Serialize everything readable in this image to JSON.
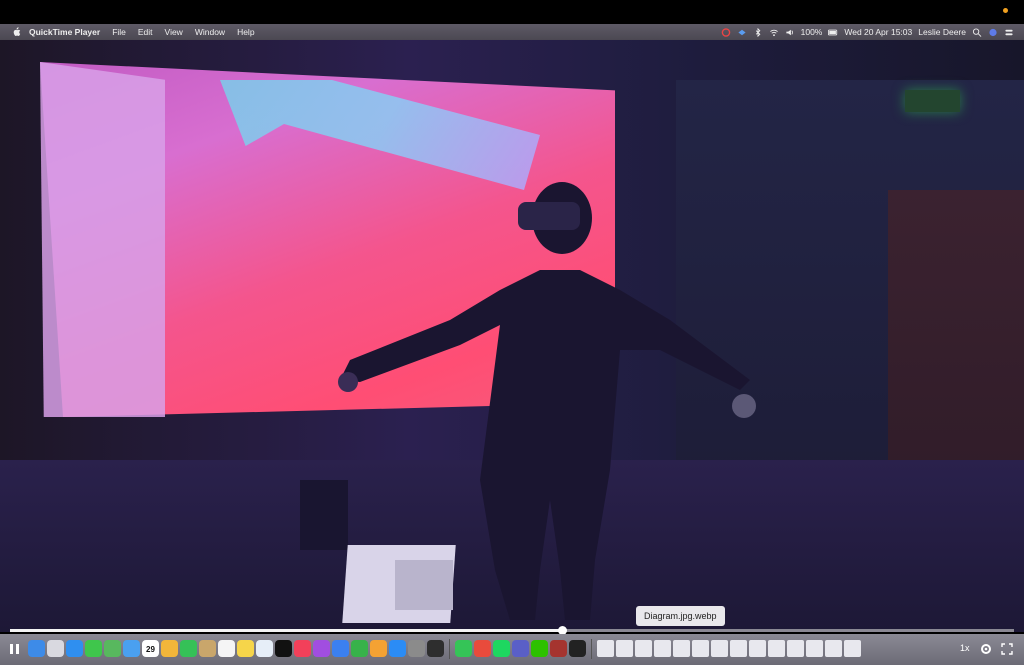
{
  "menubar": {
    "app_name": "QuickTime Player",
    "menus": [
      "File",
      "Edit",
      "View",
      "Window",
      "Help"
    ],
    "battery": "100%",
    "datetime": "Wed 20 Apr  15:03",
    "user": "Leslie Deere",
    "icons": [
      "creative-cloud-icon",
      "dropbox-icon",
      "bluetooth-icon",
      "wifi-icon",
      "volume-icon",
      "search-icon",
      "siri-icon",
      "control-center-icon"
    ]
  },
  "player": {
    "progress": 0.55,
    "tooltip": "Diagram.jpg.webp",
    "playback_rate": "1x"
  },
  "dock": {
    "calendar_day": "29",
    "apps": [
      {
        "name": "finder",
        "color": "#3d8be8"
      },
      {
        "name": "launchpad",
        "color": "#d9d9e0"
      },
      {
        "name": "safari",
        "color": "#2f8ff0"
      },
      {
        "name": "messages",
        "color": "#3fc64c"
      },
      {
        "name": "maps",
        "color": "#58b85e"
      },
      {
        "name": "mail",
        "color": "#4aa0f0"
      },
      {
        "name": "calendar",
        "color": "#ffffff"
      },
      {
        "name": "photos",
        "color": "#f2b63a"
      },
      {
        "name": "facetime",
        "color": "#35c157"
      },
      {
        "name": "contacts",
        "color": "#c9a66b"
      },
      {
        "name": "reminders",
        "color": "#f5f5f5"
      },
      {
        "name": "notes",
        "color": "#f6d54a"
      },
      {
        "name": "freeform",
        "color": "#e6eef8"
      },
      {
        "name": "apple-tv",
        "color": "#111111"
      },
      {
        "name": "music",
        "color": "#f2405a"
      },
      {
        "name": "podcasts",
        "color": "#a14ee0"
      },
      {
        "name": "keynote",
        "color": "#3b80f0"
      },
      {
        "name": "numbers",
        "color": "#37b24a"
      },
      {
        "name": "pages",
        "color": "#f4a233"
      },
      {
        "name": "app-store",
        "color": "#2b8cf5"
      },
      {
        "name": "system-preferences",
        "color": "#8b8b8b"
      },
      {
        "name": "activity-monitor",
        "color": "#2e2e2e"
      },
      {
        "name": "whatsapp",
        "color": "#35c457"
      },
      {
        "name": "chrome",
        "color": "#e94b3c"
      },
      {
        "name": "spotify",
        "color": "#1ed760"
      },
      {
        "name": "teams",
        "color": "#5a5fc7"
      },
      {
        "name": "wechat",
        "color": "#2dc100"
      },
      {
        "name": "dictionary",
        "color": "#a5342f"
      },
      {
        "name": "quicktime",
        "color": "#222222"
      }
    ],
    "docs": [
      "doc-1",
      "doc-2",
      "doc-3",
      "doc-4",
      "doc-5",
      "doc-6",
      "doc-7",
      "doc-8",
      "doc-9",
      "doc-10",
      "doc-11",
      "doc-12",
      "doc-13",
      "doc-14"
    ]
  }
}
